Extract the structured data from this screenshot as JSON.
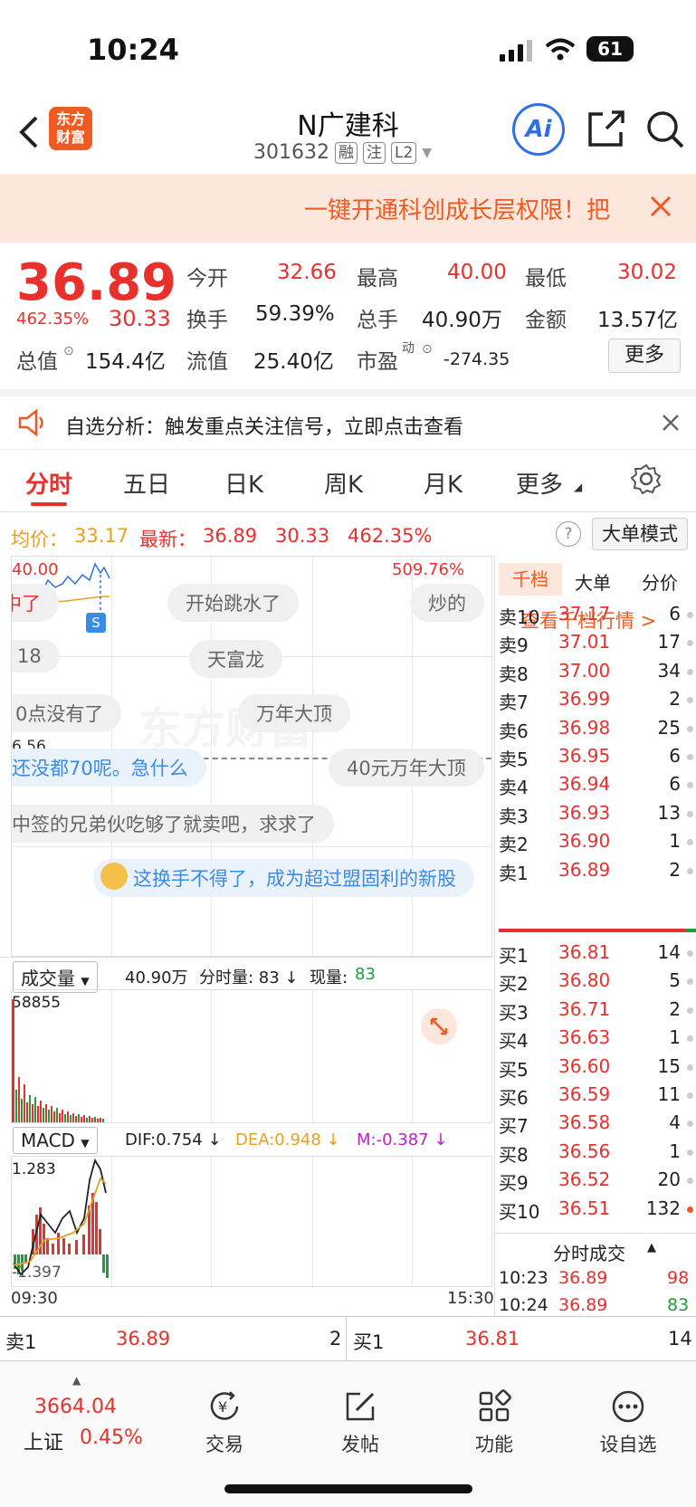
{
  "status": {
    "time": "10:24",
    "battery": "61"
  },
  "header": {
    "title": "N广建科",
    "code": "301632",
    "tags": [
      "融",
      "注",
      "L2"
    ],
    "logo_line1": "东方",
    "logo_line2": "财富",
    "ai_label": "Ai"
  },
  "promo": {
    "text": "一键开通科创成长层权限！把"
  },
  "quote": {
    "price": "36.89",
    "pct": "462.35%",
    "chg": "30.33",
    "open_label": "今开",
    "open": "32.66",
    "high_label": "最高",
    "high": "40.00",
    "low_label": "最低",
    "low": "30.02",
    "turnover_label": "换手",
    "turnover": "59.39%",
    "volume_label": "总手",
    "volume": "40.90万",
    "amount_label": "金额",
    "amount": "13.57亿",
    "mktcap_label": "总值",
    "mktcap": "154.4亿",
    "float_label": "流值",
    "float": "25.40亿",
    "pe_label": "市盈",
    "pe_sup": "动",
    "pe": "-274.35",
    "more_button": "更多"
  },
  "notice": {
    "text": "自选分析：触发重点关注信号，立即点击查看"
  },
  "tabs": [
    "分时",
    "五日",
    "日K",
    "周K",
    "月K",
    "更多"
  ],
  "info": {
    "avg_label": "均价：",
    "avg": "33.17",
    "latest_label": "最新：",
    "latest": "36.89",
    "chg": "30.33",
    "pct": "462.35%",
    "mode_button": "大单模式"
  },
  "chart": {
    "top_price": "40.00",
    "top_pct": "509.76%",
    "mid_price": "6.56",
    "comments": [
      "中了",
      "开始跳水了",
      "炒的",
      "18",
      "天富龙",
      "0点没有了",
      "万年大顶",
      "还没都70呢。急什么",
      "40元万年大顶",
      "中签的兄弟伙吃够了就卖吧，求求了",
      "这换手不得了，成为超过盟固利的新股"
    ],
    "s_marker": "S",
    "watermark": "东方财富"
  },
  "volume": {
    "selector": "成交量",
    "summary": "40.90万",
    "interval_label": "分时量: 83 ↓",
    "now_label": "现量:",
    "now": "83",
    "max": "58855"
  },
  "macd": {
    "selector": "MACD",
    "dif": "DIF:0.754 ↓",
    "dea": "DEA:0.948 ↓",
    "m": "M:-0.387 ↓",
    "top": "1.283",
    "bottom": "-1.397",
    "time_start": "09:30",
    "time_end": "15:30"
  },
  "book": {
    "tabs": [
      "千档",
      "大单",
      "分价"
    ],
    "link": "查看千档行情 >",
    "asks": [
      {
        "label": "卖10",
        "price": "37.17",
        "qty": "6"
      },
      {
        "label": "卖9",
        "price": "37.01",
        "qty": "17"
      },
      {
        "label": "卖8",
        "price": "37.00",
        "qty": "34"
      },
      {
        "label": "卖7",
        "price": "36.99",
        "qty": "2"
      },
      {
        "label": "卖6",
        "price": "36.98",
        "qty": "25"
      },
      {
        "label": "卖5",
        "price": "36.95",
        "qty": "6"
      },
      {
        "label": "卖4",
        "price": "36.94",
        "qty": "6"
      },
      {
        "label": "卖3",
        "price": "36.93",
        "qty": "13"
      },
      {
        "label": "卖2",
        "price": "36.90",
        "qty": "1"
      },
      {
        "label": "卖1",
        "price": "36.89",
        "qty": "2"
      }
    ],
    "bids": [
      {
        "label": "买1",
        "price": "36.81",
        "qty": "14"
      },
      {
        "label": "买2",
        "price": "36.80",
        "qty": "5"
      },
      {
        "label": "买3",
        "price": "36.71",
        "qty": "2"
      },
      {
        "label": "买4",
        "price": "36.63",
        "qty": "1"
      },
      {
        "label": "买5",
        "price": "36.60",
        "qty": "15"
      },
      {
        "label": "买6",
        "price": "36.59",
        "qty": "11"
      },
      {
        "label": "买7",
        "price": "36.58",
        "qty": "4"
      },
      {
        "label": "买8",
        "price": "36.56",
        "qty": "1"
      },
      {
        "label": "买9",
        "price": "36.52",
        "qty": "20"
      },
      {
        "label": "买10",
        "price": "36.51",
        "qty": "132"
      }
    ],
    "ticks_title": "分时成交",
    "ticks": [
      {
        "time": "10:23",
        "price": "36.89",
        "qty": "98"
      },
      {
        "time": "10:24",
        "price": "36.89",
        "qty": "83"
      }
    ]
  },
  "summary": {
    "sell_label": "卖1",
    "sell_price": "36.89",
    "sell_qty": "2",
    "buy_label": "买1",
    "buy_price": "36.81",
    "buy_qty": "14"
  },
  "nav": {
    "index_value": "3664.04",
    "index_name": "上证",
    "index_pct": "0.45%",
    "items": [
      "交易",
      "发帖",
      "功能",
      "设自选"
    ]
  }
}
